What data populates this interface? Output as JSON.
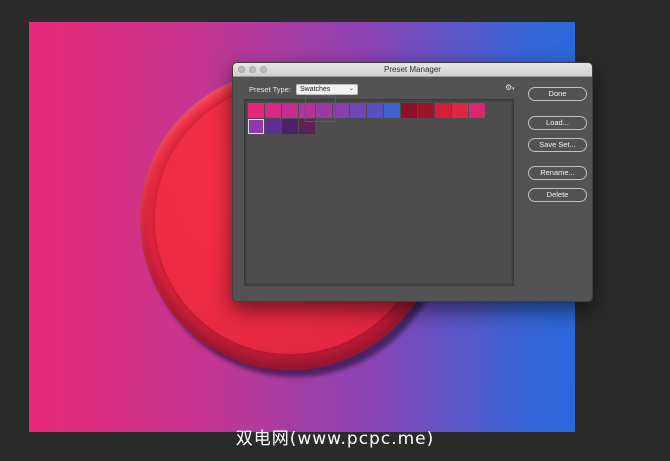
{
  "dialog": {
    "title": "Preset Manager",
    "preset_type_label": "Preset Type:",
    "preset_type_value": "Swatches",
    "gear_icon": "gear-icon",
    "buttons": {
      "done": "Done",
      "load": "Load...",
      "save_set": "Save Set...",
      "rename": "Rename...",
      "delete": "Delete"
    },
    "swatches": [
      "#e8257a",
      "#d52a84",
      "#c42e8c",
      "#b0349a",
      "#9b3aa4",
      "#8a3fad",
      "#6f47b6",
      "#5a4fc0",
      "#3f62d1",
      "#8c1125",
      "#a0142b",
      "#d31f3c",
      "#e3244a",
      "#d82870",
      "#8e3aaa",
      "#5f2e92",
      "#4a2468",
      "#5a2350"
    ],
    "selected_swatch_index": 14
  },
  "canvas": {
    "gradient_colors": [
      "#e82a78",
      "#8c43b4",
      "#2a69db"
    ],
    "circle_color": "#ec2a43"
  },
  "watermark": "双电网(www.pcpc.me)"
}
